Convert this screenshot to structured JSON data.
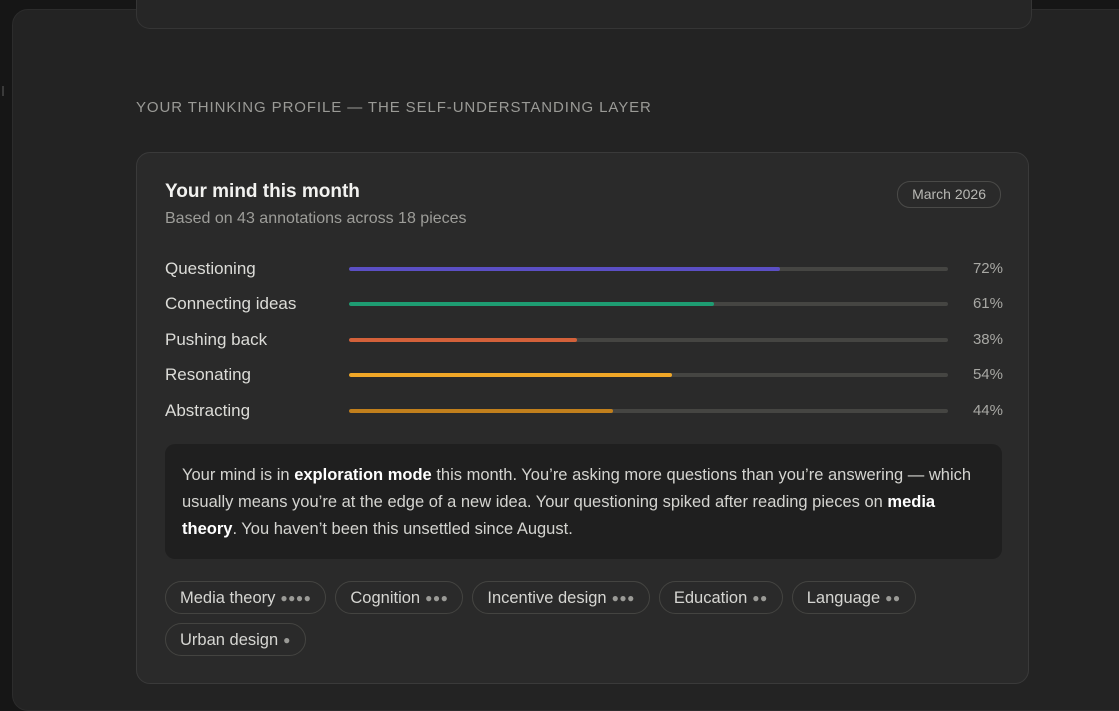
{
  "section": {
    "title": "YOUR THINKING PROFILE — THE SELF-UNDERSTANDING LAYER"
  },
  "card": {
    "title": "Your mind this month",
    "subtitle": "Based on 43 annotations across 18 pieces",
    "period_badge": "March 2026"
  },
  "metrics": [
    {
      "label": "Questioning",
      "value": 72,
      "value_text": "72%",
      "color": "#5b4fc4"
    },
    {
      "label": "Connecting ideas",
      "value": 61,
      "value_text": "61%",
      "color": "#1e9c72"
    },
    {
      "label": "Pushing back",
      "value": 38,
      "value_text": "38%",
      "color": "#d3613a"
    },
    {
      "label": "Resonating",
      "value": 54,
      "value_text": "54%",
      "color": "#f0a727"
    },
    {
      "label": "Abstracting",
      "value": 44,
      "value_text": "44%",
      "color": "#c17f1c"
    }
  ],
  "insight": {
    "p1": "Your mind is in ",
    "b1": "exploration mode",
    "p2": " this month. You’re asking more questions than you’re answering — which usually means you’re at the edge of a new idea. Your questioning spiked after reading pieces on ",
    "b2": "media theory",
    "p3": ". You haven’t been this unsettled since August."
  },
  "tags": [
    {
      "label": "Media theory",
      "dots": "●●●●"
    },
    {
      "label": "Cognition",
      "dots": "●●●"
    },
    {
      "label": "Incentive design",
      "dots": "●●●"
    },
    {
      "label": "Education",
      "dots": "●●"
    },
    {
      "label": "Language",
      "dots": "●●"
    },
    {
      "label": "Urban design",
      "dots": "●"
    }
  ]
}
